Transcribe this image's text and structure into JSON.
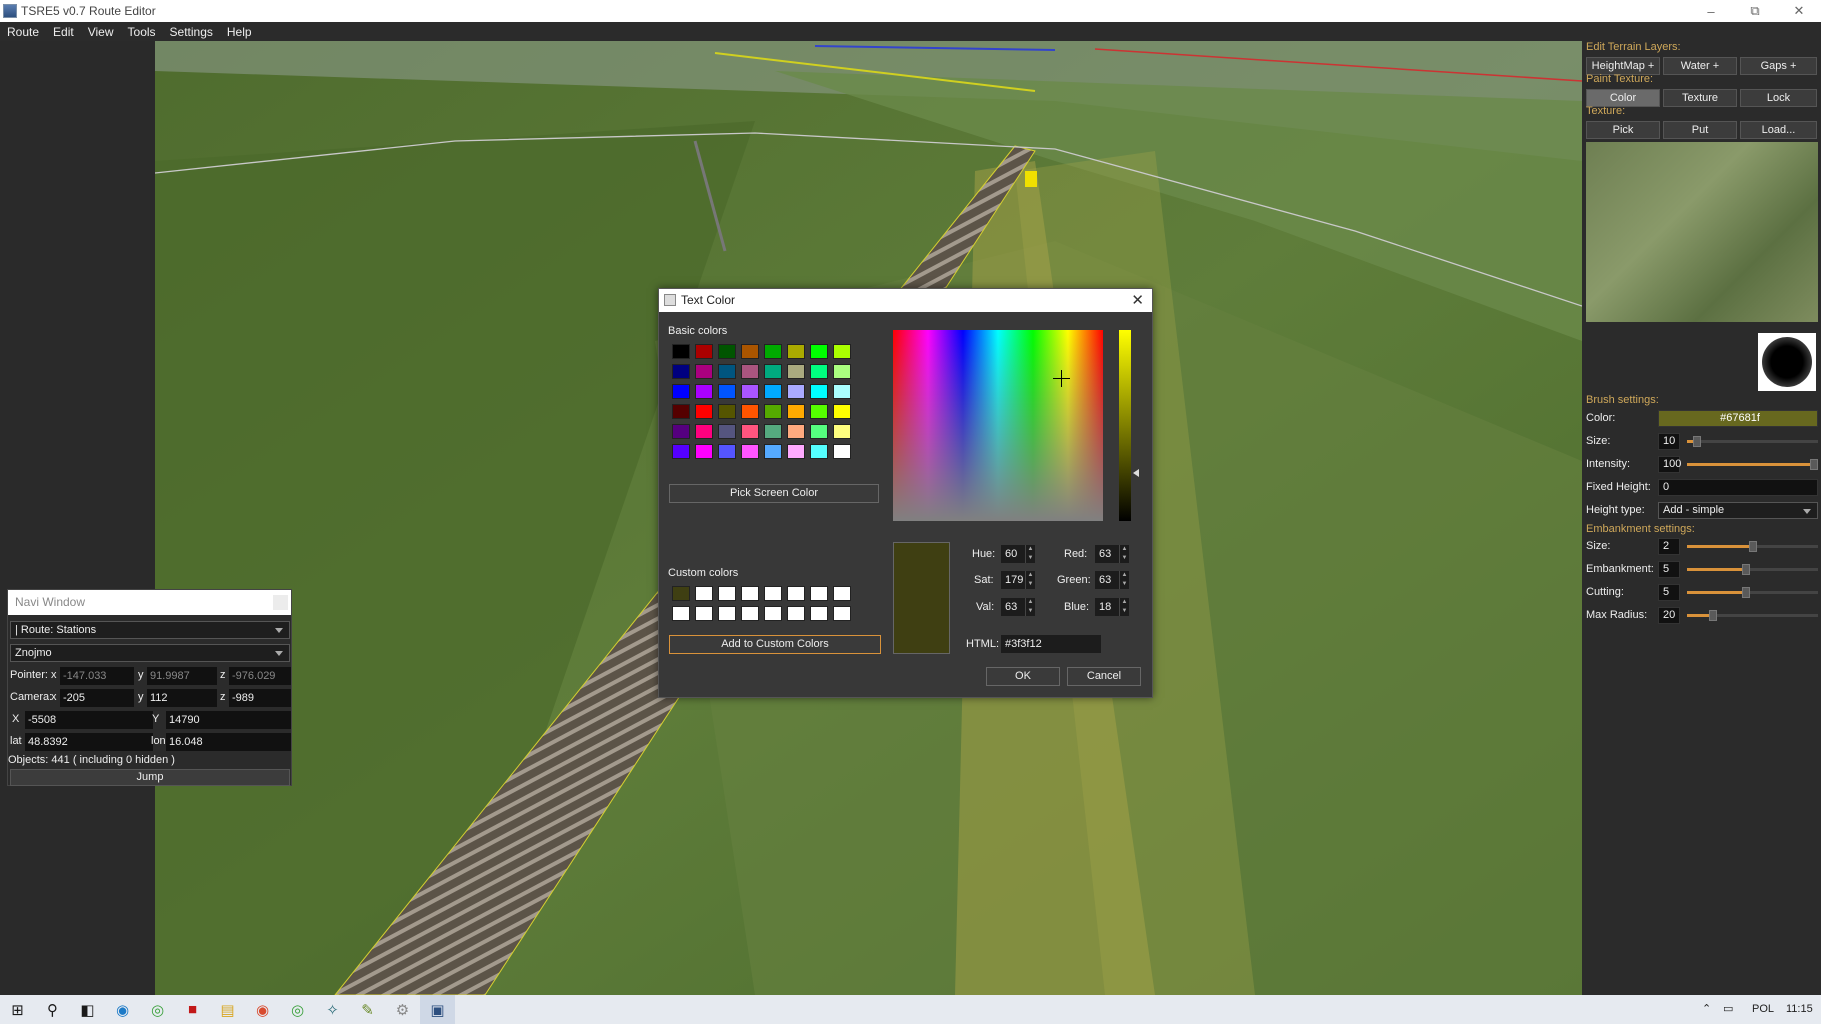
{
  "window": {
    "title": "TSRE5 v0.7 Route Editor"
  },
  "menu": [
    "Route",
    "Edit",
    "View",
    "Tools",
    "Settings",
    "Help"
  ],
  "right_panel": {
    "edit_terrain_layers_label": "Edit Terrain Layers:",
    "heightmap": "HeightMap +",
    "water": "Water +",
    "gaps": "Gaps +",
    "paint_texture_label": "Paint Texture:",
    "color_btn": "Color",
    "texture_btn": "Texture",
    "lock_btn": "Lock",
    "texture_label": "Texture:",
    "pick": "Pick",
    "put": "Put",
    "load": "Load...",
    "brush_settings_label": "Brush settings:",
    "brush": {
      "color_label": "Color:",
      "color_value": "#67681f",
      "color_hex": "#67681f",
      "size_label": "Size:",
      "size_value": "10",
      "size_level": 0.08,
      "intensity_label": "Intensity:",
      "intensity_value": "100",
      "intensity_level": 1.0,
      "fixed_height_label": "Fixed Height:",
      "fixed_height_value": "0",
      "height_type_label": "Height type:",
      "height_type_value": "Add - simple"
    },
    "embankment_settings_label": "Embankment settings:",
    "embankment": {
      "size_label": "Size:",
      "size_value": "2",
      "size_level": 0.5,
      "embankment_label": "Embankment:",
      "embankment_value": "5",
      "embankment_level": 0.45,
      "cutting_label": "Cutting:",
      "cutting_value": "5",
      "cutting_level": 0.45,
      "max_radius_label": "Max Radius:",
      "max_radius_value": "20",
      "max_radius_level": 0.2
    }
  },
  "navi": {
    "title": "Navi Window",
    "route_combo": "| Route: Stations",
    "station_combo": "Znojmo",
    "pointer_label": "Pointer:",
    "pointer_x": "-147.033",
    "pointer_y": "91.9987",
    "pointer_z": "-976.029",
    "camera_label": "Camera:",
    "camera_x": "-205",
    "camera_y": "112",
    "camera_z": "-989",
    "x_label": "X",
    "y_label": "Y",
    "z_label": "z",
    "lx": "x",
    "ly": "y",
    "tile_x": "-5508",
    "tile_y": "14790",
    "lat_label": "lat",
    "lat": "48.8392",
    "lon_label": "lon",
    "lon": "16.048",
    "objects": "Objects: 441 ( including 0 hidden )",
    "jump": "Jump"
  },
  "dialog": {
    "title": "Text Color",
    "basic_colors_label": "Basic colors",
    "basic_colors": [
      "#000000",
      "#aa0000",
      "#005500",
      "#aa5500",
      "#00aa00",
      "#aaaa00",
      "#00ff00",
      "#aaff00",
      "#00007f",
      "#aa007f",
      "#00557f",
      "#aa557f",
      "#00aa7f",
      "#aaaa7f",
      "#00ff7f",
      "#aaff7f",
      "#0000ff",
      "#aa00ff",
      "#0055ff",
      "#aa55ff",
      "#00aaff",
      "#aaaaff",
      "#00ffff",
      "#aaffff",
      "#550000",
      "#ff0000",
      "#555500",
      "#ff5500",
      "#55aa00",
      "#ffaa00",
      "#55ff00",
      "#ffff00",
      "#55007f",
      "#ff007f",
      "#55557f",
      "#ff557f",
      "#55aa7f",
      "#ffaa7f",
      "#55ff7f",
      "#ffff7f",
      "#5500ff",
      "#ff00ff",
      "#5555ff",
      "#ff55ff",
      "#55aaff",
      "#ffaaff",
      "#55ffff",
      "#ffffff"
    ],
    "pick_screen_color": "Pick Screen Color",
    "custom_colors_label": "Custom colors",
    "custom_colors": [
      "#3f3f12",
      "#ffffff",
      "#ffffff",
      "#ffffff",
      "#ffffff",
      "#ffffff",
      "#ffffff",
      "#ffffff",
      "#ffffff",
      "#ffffff",
      "#ffffff",
      "#ffffff",
      "#ffffff",
      "#ffffff",
      "#ffffff",
      "#ffffff"
    ],
    "add_to_custom": "Add to Custom Colors",
    "hue_label": "Hue:",
    "hue": "60",
    "sat_label": "Sat:",
    "sat": "179",
    "val_label": "Val:",
    "val": "63",
    "red_label": "Red:",
    "red": "63",
    "green_label": "Green:",
    "green": "63",
    "blue_label": "Blue:",
    "blue": "18",
    "html_label": "HTML:",
    "html": "#3f3f12",
    "current_color": "#3f3f12",
    "ok": "OK",
    "cancel": "Cancel"
  },
  "taskbar": {
    "language": "POL",
    "time": "11:15"
  }
}
